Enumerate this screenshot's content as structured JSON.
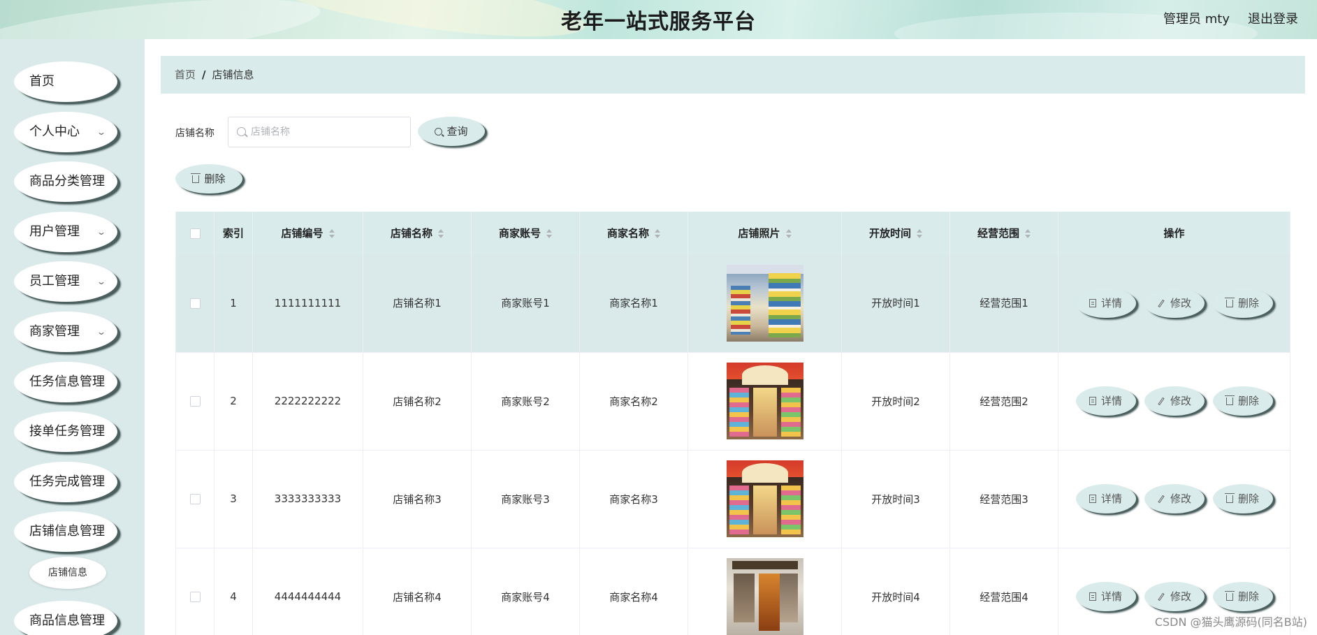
{
  "header": {
    "title": "老年一站式服务平台",
    "user": "管理员 mty",
    "logout": "退出登录"
  },
  "sidebar": {
    "items": [
      {
        "label": "首页",
        "has_arrow": false
      },
      {
        "label": "个人中心",
        "has_arrow": true
      },
      {
        "label": "商品分类管理",
        "has_arrow": false
      },
      {
        "label": "用户管理",
        "has_arrow": true
      },
      {
        "label": "员工管理",
        "has_arrow": true
      },
      {
        "label": "商家管理",
        "has_arrow": true
      },
      {
        "label": "任务信息管理",
        "has_arrow": false
      },
      {
        "label": "接单任务管理",
        "has_arrow": false
      },
      {
        "label": "任务完成管理",
        "has_arrow": false
      },
      {
        "label": "店铺信息管理",
        "has_arrow": false
      },
      {
        "label": "商品信息管理",
        "has_arrow": false
      }
    ],
    "submenu": {
      "label": "店铺信息"
    },
    "arrow_glyph": "⌄"
  },
  "breadcrumb": {
    "home": "首页",
    "separator": "/",
    "current": "店铺信息"
  },
  "search": {
    "label": "店铺名称",
    "placeholder": "店铺名称",
    "value": "",
    "button": "查询"
  },
  "toolbar": {
    "delete_label": "删除"
  },
  "table": {
    "columns": [
      "索引",
      "店铺编号",
      "店铺名称",
      "商家账号",
      "商家名称",
      "店铺照片",
      "开放时间",
      "经营范围",
      "操作"
    ],
    "rows": [
      {
        "index": "1",
        "shop_no": "1111111111",
        "shop_name": "店铺名称1",
        "merchant_account": "商家账号1",
        "merchant_name": "商家名称1",
        "photo": "supermarket-aisle",
        "open_time": "开放时间1",
        "business_scope": "经营范围1",
        "highlight": true
      },
      {
        "index": "2",
        "shop_no": "2222222222",
        "shop_name": "店铺名称2",
        "merchant_account": "商家账号2",
        "merchant_name": "商家名称2",
        "photo": "toy-store-front",
        "open_time": "开放时间2",
        "business_scope": "经营范围2",
        "highlight": false
      },
      {
        "index": "3",
        "shop_no": "3333333333",
        "shop_name": "店铺名称3",
        "merchant_account": "商家账号3",
        "merchant_name": "商家名称3",
        "photo": "toy-store-front",
        "open_time": "开放时间3",
        "business_scope": "经营范围3",
        "highlight": false
      },
      {
        "index": "4",
        "shop_no": "4444444444",
        "shop_name": "店铺名称4",
        "merchant_account": "商家账号4",
        "merchant_name": "商家名称4",
        "photo": "boutique-storefront",
        "open_time": "开放时间4",
        "business_scope": "经营范围4",
        "highlight": false
      }
    ],
    "actions": {
      "detail": "详情",
      "edit": "修改",
      "delete": "删除"
    }
  },
  "watermark": "CSDN @猫头鹰源码(同名B站)",
  "colors": {
    "accent_bg": "#d9ebeb",
    "sidebar_bg": "#daeaea",
    "button_shadow": "#4b5f5f"
  }
}
